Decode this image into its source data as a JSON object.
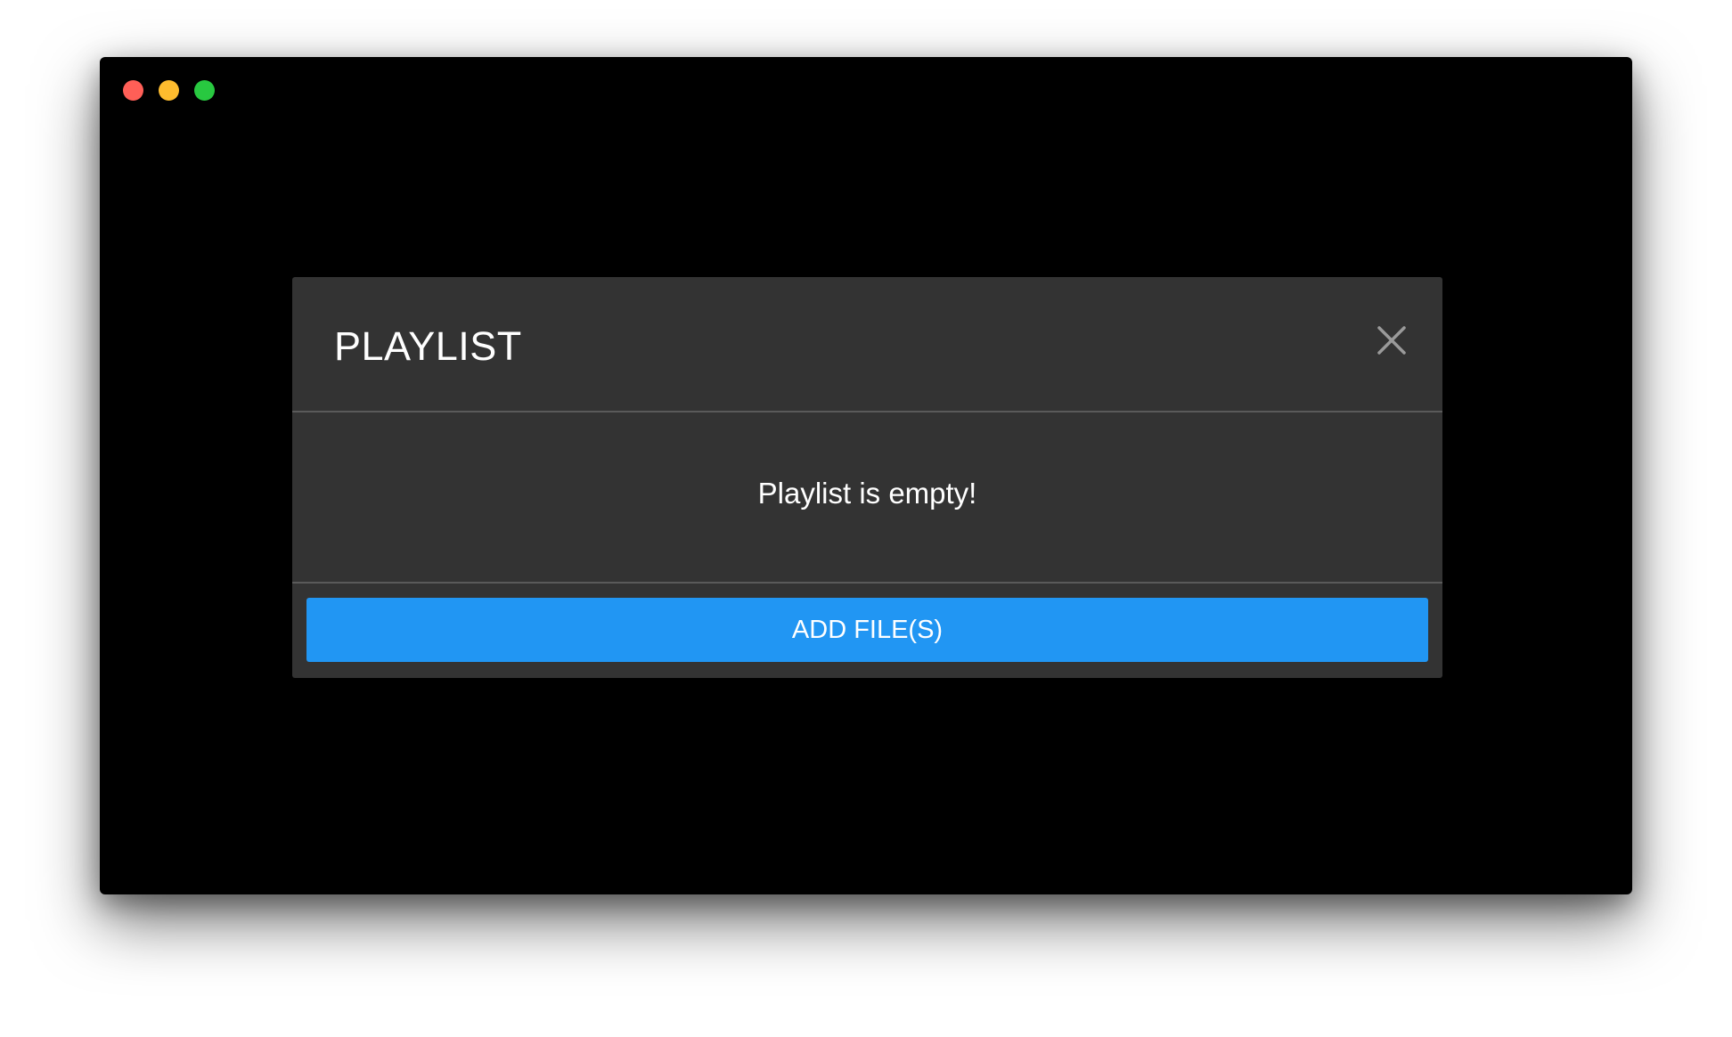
{
  "window": {
    "controls": [
      {
        "name": "close",
        "color": "#ff5f57"
      },
      {
        "name": "minimize",
        "color": "#febc2e"
      },
      {
        "name": "maximize",
        "color": "#28c840"
      }
    ]
  },
  "dialog": {
    "title": "PLAYLIST",
    "close_icon": "close-icon",
    "empty_message": "Playlist is empty!",
    "add_button_label": "ADD FILE(S)",
    "accent_color": "#2196f3",
    "background_color": "#333333"
  }
}
